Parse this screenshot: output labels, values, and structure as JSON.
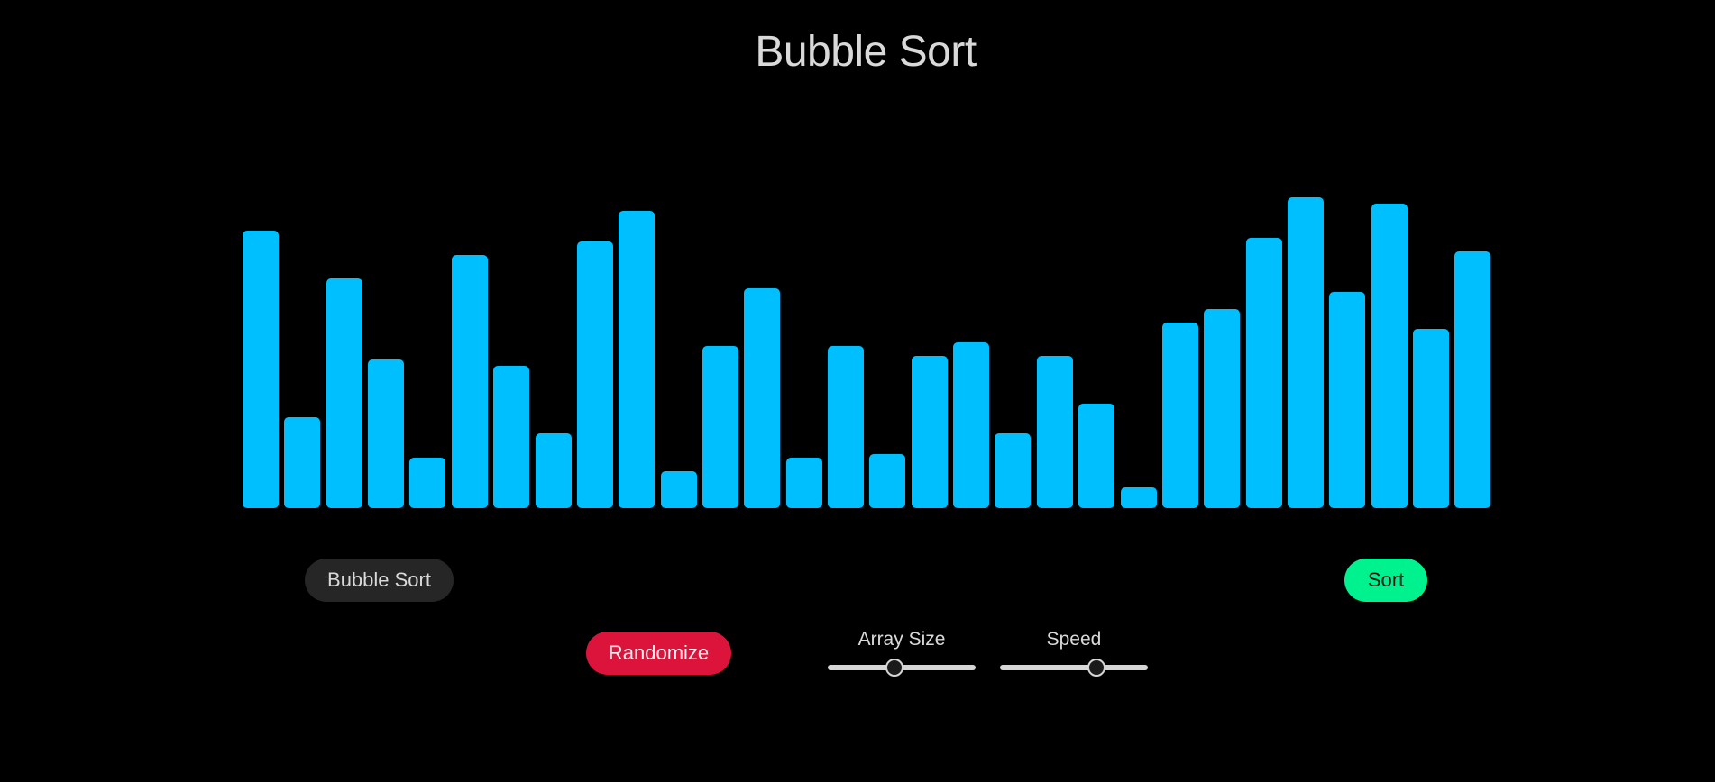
{
  "app": {
    "title": "Bubble Sort"
  },
  "colors": {
    "background": "#000000",
    "bar": "#00bfff",
    "sort_button": "#00f28f",
    "randomize_button": "#dc143c"
  },
  "chart_data": {
    "type": "bar",
    "values": [
      82,
      27,
      68,
      44,
      15,
      75,
      42,
      22,
      79,
      88,
      11,
      48,
      65,
      15,
      48,
      16,
      45,
      49,
      22,
      45,
      31,
      6,
      55,
      59,
      80,
      92,
      64,
      90,
      53,
      76
    ],
    "ylim": [
      0,
      100
    ]
  },
  "controls": {
    "algorithm_label": "Bubble Sort",
    "sort_label": "Sort",
    "randomize_label": "Randomize",
    "array_size": {
      "label": "Array Size",
      "value": 0.44
    },
    "speed": {
      "label": "Speed",
      "value": 0.64
    }
  }
}
